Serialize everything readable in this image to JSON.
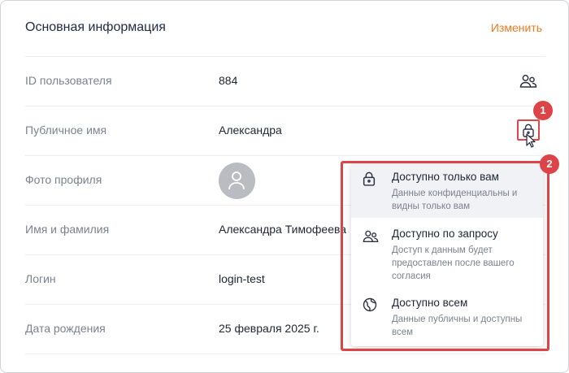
{
  "header": {
    "title": "Основная информация",
    "edit_label": "Изменить"
  },
  "rows": [
    {
      "label": "ID пользователя",
      "value": "884",
      "icon": "users-icon"
    },
    {
      "label": "Публичное имя",
      "value": "Александра",
      "icon": "lock-icon"
    },
    {
      "label": "Фото профиля",
      "value": "",
      "icon": "avatar"
    },
    {
      "label": "Имя и фамилия",
      "value": "Александра Тимофеева"
    },
    {
      "label": "Логин",
      "value": "login-test"
    },
    {
      "label": "Дата рождения",
      "value": "25 февраля 2025 г."
    }
  ],
  "badges": [
    "1",
    "2"
  ],
  "privacy_menu": {
    "items": [
      {
        "title": "Доступно только вам",
        "description": "Данные конфиденциальны и видны только вам",
        "icon": "lock-icon",
        "selected": true
      },
      {
        "title": "Доступно по запросу",
        "description": "Доступ к данным будет предоставлен после вашего согласия",
        "icon": "users-icon",
        "selected": false
      },
      {
        "title": "Доступно всем",
        "description": "Данные публичны и доступны всем",
        "icon": "globe-icon",
        "selected": false
      }
    ]
  },
  "colors": {
    "accent": "#f07a1f",
    "highlight": "#dd4448",
    "muted": "#7b8190"
  }
}
